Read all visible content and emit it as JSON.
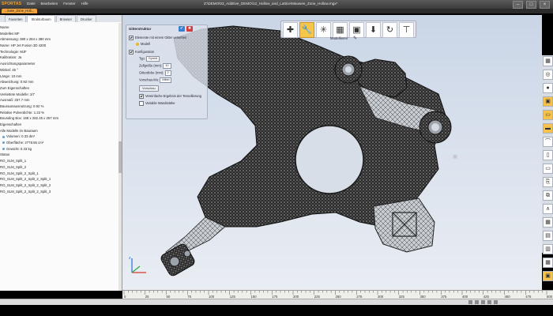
{
  "app": {
    "logo": "SPORTAS",
    "menu": [
      "Datei",
      "Bearbeiten",
      "Fenster",
      "Hilfe"
    ],
    "window_title": "Z:\\DEMO\\03_Additive_DEMO\\12_Hollow_and_Lattice\\Mauwee_Zone_Hollow.mgx*",
    "doc_tab": "...luwe_Zone_Holl..."
  },
  "left_panel": {
    "tabs": [
      "Favoriten",
      "Strukturbaum",
      "Browser",
      "Drucker"
    ],
    "active_tab": "Strukturbaum",
    "rows": [
      "Name",
      "Modelles MF",
      "Abmessung: 380 x 284 x 380 mm",
      "Name: HP Jet Fusion 3D 4200",
      "Technologie: MJF",
      "Kalibration: Ja",
      "Ausrichtungsparameter",
      "Winkel: 45 °",
      "Länge: 10 mm",
      "Abweichung: 0.92 mm",
      "Zum Eigenschaften",
      "Verkettete Modelle: 2/7",
      "Ausmaß: 257.7 mm",
      "Bauraumausnutzung: 0.92 %",
      "Relative Pulverdichte: 1.22 %",
      "Bounding Box: 168 x 282.45 x 257 mm",
      "Eigenschaften",
      "Alle Modelle im Bauraum",
      "Volumen: 0.33 dm³",
      "Oberfläche: 2778.55 cm²",
      "Gewicht: 0.33 kg",
      "Status",
      "RO_SLM_Split_1",
      "RO_SLM_Split_2",
      "RO_SLM_Split_2_Split_1",
      "RO_SLM_Split_2_Split_2_Split_1",
      "RO_SLM_Split_2_Split_2_Split_2",
      "RO_SLM_Split_2_Split_2_Split_3"
    ]
  },
  "float_panel": {
    "title": "Gitterstruktur",
    "row1": "Elemente mit einem Gitter versehen",
    "row2": "Modell",
    "row3": "Konfiguration",
    "typ_label": "Typ:",
    "typ_value": "Gyroid",
    "cell_label": "Zellgröße (mm):",
    "cell_value": "10",
    "thick_label": "Gitterdicke (mm):",
    "thick_value": "2",
    "preview_label": "Vorschau-Mo:",
    "preview_value": "Mittel",
    "preview_button": "Vorschau",
    "check1": "Vereinfache Ergebnis der Tessellierung",
    "check2": "Variable Wandstärke"
  },
  "toolbar": {
    "icons": [
      "plus-icon",
      "wrench-icon",
      "spark-icon",
      "bar-chart-icon",
      "layers-icon",
      "export-icon",
      "refresh-icon",
      "support-icon"
    ],
    "glyphs": [
      "✚",
      "🔧",
      "✳",
      "▦",
      "▣",
      "⬇",
      "↻",
      "⊤"
    ],
    "active_index": 1,
    "label": "Modellieren"
  },
  "right_toolbar": {
    "glyphs": [
      "▦",
      "◎",
      "●",
      "▣",
      "▭",
      "▬",
      "⌒",
      "▯",
      "▭",
      "⎘",
      "⧉",
      "∧",
      "▦",
      "▤",
      "▥",
      "▦",
      "▣"
    ],
    "highlighted": [
      3,
      4,
      5,
      16
    ]
  },
  "ruler": {
    "ticks": [
      "0",
      "25",
      "50",
      "75",
      "100",
      "125",
      "150",
      "175",
      "200",
      "225",
      "250",
      "275",
      "300",
      "325",
      "350",
      "375",
      "400",
      "425",
      "450",
      "475",
      "500"
    ]
  },
  "colors": {
    "accent": "#f2a23a",
    "viewport_top": "#c9d5e6",
    "model_dark": "#2a2a2a"
  }
}
